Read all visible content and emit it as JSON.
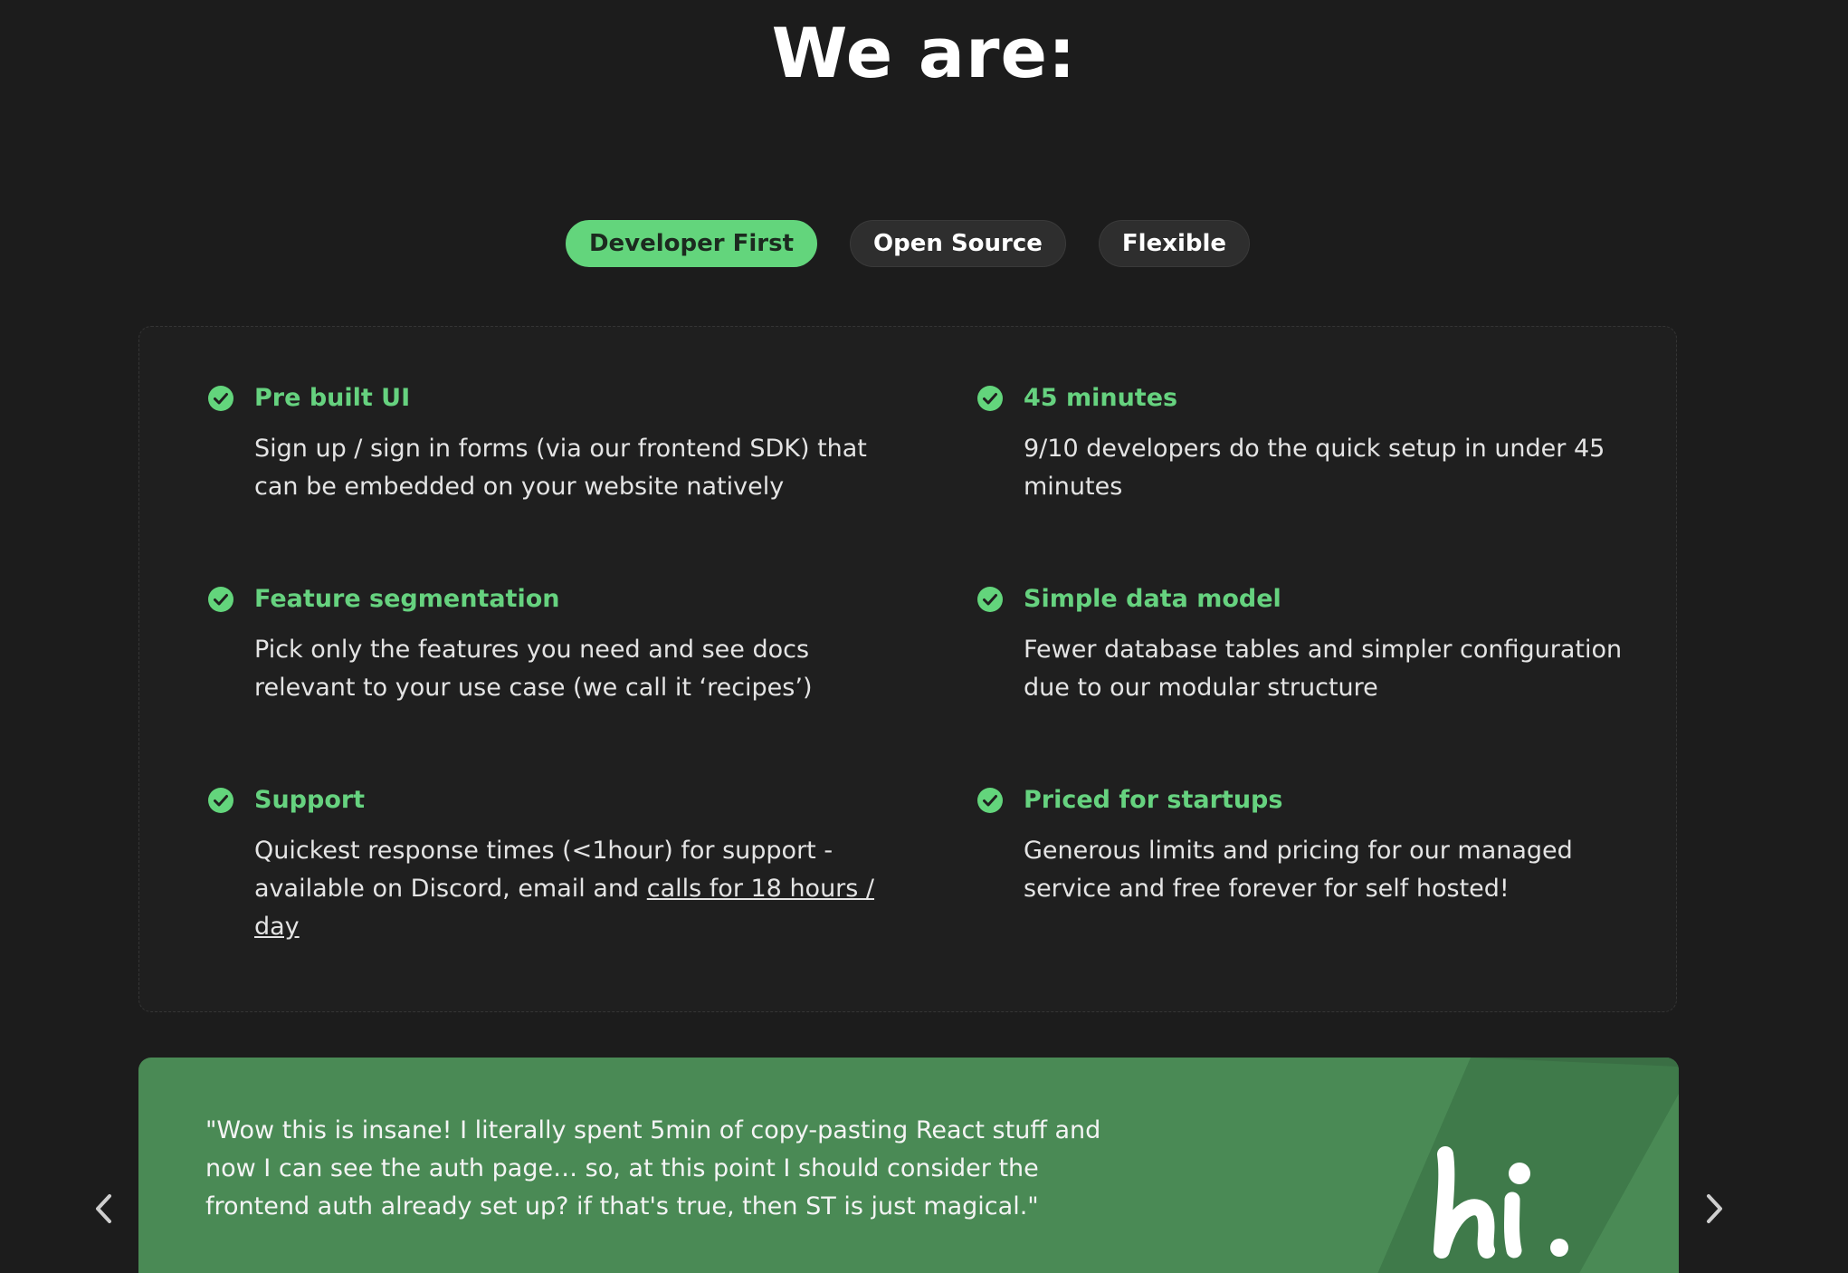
{
  "heading": "We are:",
  "tabs": [
    {
      "label": "Developer First",
      "active": true
    },
    {
      "label": "Open Source",
      "active": false
    },
    {
      "label": "Flexible",
      "active": false
    }
  ],
  "features": {
    "left": [
      {
        "title": "Pre built UI",
        "desc": "Sign up / sign in forms (via our frontend SDK) that can be embedded on your website natively"
      },
      {
        "title": "Feature segmentation",
        "desc": "Pick only the features you need and see docs relevant to your use case (we call it ‘recipes’)"
      },
      {
        "title": "Support",
        "desc_prefix": "Quickest response times (<1hour) for support - available on Discord, email and ",
        "desc_link": "calls for 18 hours / day"
      }
    ],
    "right": [
      {
        "title": "45 minutes",
        "desc": "9/10 developers do the quick setup in under 45 minutes"
      },
      {
        "title": "Simple data model",
        "desc": "Fewer database tables and simpler configuration due to our modular structure"
      },
      {
        "title": "Priced for startups",
        "desc": "Generous limits and pricing for our managed service and free forever for self hosted!"
      }
    ]
  },
  "testimonial": {
    "quote": "\"Wow this is insane! I literally spent 5min of copy-pasting React stuff and now I can see the auth page… so, at this point I should consider the frontend auth already set up? if that's true, then ST is just magical.\"",
    "logo_text": "hi."
  },
  "colors": {
    "background": "#1c1c1c",
    "accent": "#63d57c",
    "card": "#4a8a55"
  },
  "icons": {
    "check": "check-circle-icon",
    "prev": "chevron-left-icon",
    "next": "chevron-right-icon"
  }
}
